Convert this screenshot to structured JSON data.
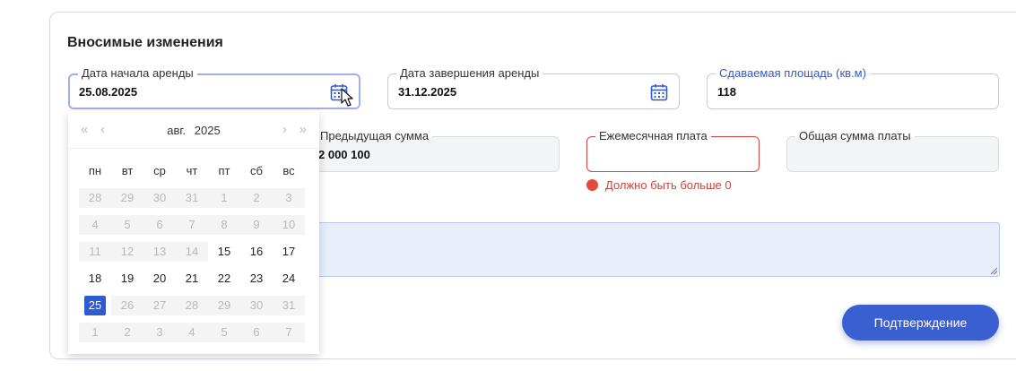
{
  "section": {
    "title": "Вносимые изменения"
  },
  "fields": {
    "start_date": {
      "label": "Дата начала аренды",
      "value": "25.08.2025"
    },
    "end_date": {
      "label": "Дата завершения аренды",
      "value": "31.12.2025"
    },
    "area": {
      "label": "Сдаваемая площадь (кв.м)",
      "value": "118"
    },
    "prev_sum": {
      "label": "Предыдущая сумма",
      "value": "2 000 100"
    },
    "monthly": {
      "label": "Ежемесячная плата",
      "value": "",
      "error": "Должно быть больше 0"
    },
    "total": {
      "label": "Общая сумма платы",
      "value": ""
    }
  },
  "datepicker": {
    "month": "авг.",
    "year": "2025",
    "nav": {
      "prev_year": "«",
      "prev_month": "‹",
      "next_month": "›",
      "next_year": "»"
    },
    "weekdays": [
      "пн",
      "вт",
      "ср",
      "чт",
      "пт",
      "сб",
      "вс"
    ],
    "weeks": [
      [
        {
          "d": "28",
          "s": "dis"
        },
        {
          "d": "29",
          "s": "dis"
        },
        {
          "d": "30",
          "s": "dis"
        },
        {
          "d": "31",
          "s": "dis"
        },
        {
          "d": "1",
          "s": "dis"
        },
        {
          "d": "2",
          "s": "dis"
        },
        {
          "d": "3",
          "s": "dis"
        }
      ],
      [
        {
          "d": "4",
          "s": "dis"
        },
        {
          "d": "5",
          "s": "dis"
        },
        {
          "d": "6",
          "s": "dis"
        },
        {
          "d": "7",
          "s": "dis"
        },
        {
          "d": "8",
          "s": "dis"
        },
        {
          "d": "9",
          "s": "dis"
        },
        {
          "d": "10",
          "s": "dis"
        }
      ],
      [
        {
          "d": "11",
          "s": "dis"
        },
        {
          "d": "12",
          "s": "dis"
        },
        {
          "d": "13",
          "s": "dis"
        },
        {
          "d": "14",
          "s": "dis"
        },
        {
          "d": "15",
          "s": ""
        },
        {
          "d": "16",
          "s": ""
        },
        {
          "d": "17",
          "s": ""
        }
      ],
      [
        {
          "d": "18",
          "s": ""
        },
        {
          "d": "19",
          "s": ""
        },
        {
          "d": "20",
          "s": ""
        },
        {
          "d": "21",
          "s": ""
        },
        {
          "d": "22",
          "s": ""
        },
        {
          "d": "23",
          "s": ""
        },
        {
          "d": "24",
          "s": ""
        }
      ],
      [
        {
          "d": "25",
          "s": "sel"
        },
        {
          "d": "26",
          "s": "dis"
        },
        {
          "d": "27",
          "s": "dis"
        },
        {
          "d": "28",
          "s": "dis"
        },
        {
          "d": "29",
          "s": "dis"
        },
        {
          "d": "30",
          "s": "dis"
        },
        {
          "d": "31",
          "s": "dis"
        }
      ],
      [
        {
          "d": "1",
          "s": "dis"
        },
        {
          "d": "2",
          "s": "dis"
        },
        {
          "d": "3",
          "s": "dis"
        },
        {
          "d": "4",
          "s": "dis"
        },
        {
          "d": "5",
          "s": "dis"
        },
        {
          "d": "6",
          "s": "dis"
        },
        {
          "d": "7",
          "s": "dis"
        }
      ]
    ]
  },
  "actions": {
    "confirm_label": "Подтверждение"
  },
  "colors": {
    "accent": "#2f5bd1",
    "error": "#d8473f"
  }
}
